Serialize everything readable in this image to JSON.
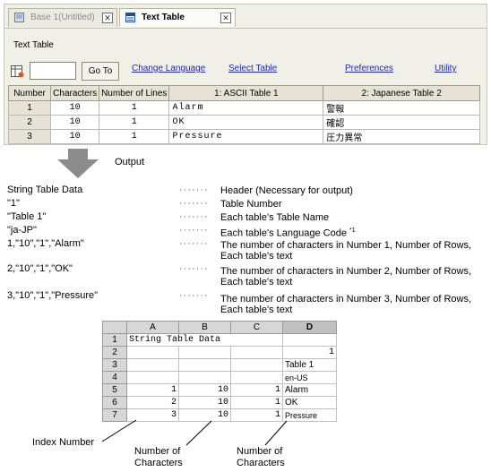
{
  "tabs": [
    {
      "label": "Base 1(Untitled)",
      "active": false
    },
    {
      "label": "Text Table",
      "active": true
    }
  ],
  "panel_title": "Text Table",
  "go_button": "Go To",
  "go_input_value": "",
  "links": {
    "change_language": "Change Language",
    "select_table": "Select Table",
    "preferences": "Preferences",
    "utility": "Utility"
  },
  "grid": {
    "headers": [
      "Number",
      "Characters",
      "Number of Lines",
      "1: ASCII Table 1",
      "2: Japanese Table 2"
    ],
    "rows": [
      {
        "num": "1",
        "chars": "10",
        "lines": "1",
        "ascii": "Alarm",
        "jp": "警報"
      },
      {
        "num": "2",
        "chars": "10",
        "lines": "1",
        "ascii": "OK",
        "jp": "確認"
      },
      {
        "num": "3",
        "chars": "10",
        "lines": "1",
        "ascii": "Pressure",
        "jp": "圧力異常"
      }
    ]
  },
  "output_label": "Output",
  "dots": "·······",
  "output_lines": [
    {
      "data": "String Table Data",
      "desc": "Header (Necessary for output)"
    },
    {
      "data": "\"1\"",
      "desc": "Table Number"
    },
    {
      "data": "\"Table 1\"",
      "desc": "Each table's Table Name"
    },
    {
      "data": "\"ja-JP\"",
      "desc": "Each table's Language Code",
      "note": "*1"
    },
    {
      "data": "1,\"10\",\"1\",\"Alarm\"",
      "desc": "The number of characters in Number 1, Number of Rows, Each table's text"
    },
    {
      "data": "2,\"10\",\"1\",\"OK\"",
      "desc": "The number of characters in Number 2, Number of Rows, Each table's text"
    },
    {
      "data": "3,\"10\",\"1\",\"Pressure\"",
      "desc": "The number of characters in Number 3, Number of Rows, Each table's text"
    }
  ],
  "sheet": {
    "columns": [
      "A",
      "B",
      "C",
      "D"
    ],
    "rows": [
      {
        "n": "1",
        "a": "String Table Data",
        "b": "",
        "c": "",
        "d": ""
      },
      {
        "n": "2",
        "a": "",
        "b": "",
        "c": "",
        "d": "1"
      },
      {
        "n": "3",
        "a": "",
        "b": "",
        "c": "",
        "d": "Table 1"
      },
      {
        "n": "4",
        "a": "",
        "b": "",
        "c": "",
        "d": "en-US"
      },
      {
        "n": "5",
        "a": "1",
        "b": "10",
        "c": "1",
        "d": "Alarm"
      },
      {
        "n": "6",
        "a": "2",
        "b": "10",
        "c": "1",
        "d": "OK"
      },
      {
        "n": "7",
        "a": "3",
        "b": "10",
        "c": "1",
        "d": "Pressure"
      }
    ]
  },
  "callouts": {
    "index_number": "Index Number",
    "num_chars_1": "Number of Characters",
    "num_chars_2": "Number of Characters"
  }
}
